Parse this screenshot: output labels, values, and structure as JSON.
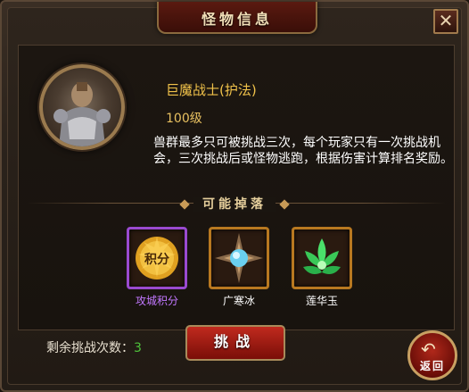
{
  "window": {
    "title": "怪物信息",
    "close_glyph": "✕"
  },
  "monster": {
    "name": "巨魔战士(护法)",
    "level": "100级",
    "description": "兽群最多只可被挑战三次，每个玩家只有一次挑战机会，三次挑战后或怪物逃跑，根据伤害计算排名奖励。"
  },
  "drops": {
    "title": "可能掉落",
    "items": [
      {
        "label": "攻城积分",
        "icon_text": "积分",
        "icon": "points-coin-icon",
        "rarity_color": "#9a4ad0"
      },
      {
        "label": "广寒冰",
        "icon": "ice-crystal-icon",
        "rarity_color": "#b87820"
      },
      {
        "label": "莲华玉",
        "icon": "lotus-jade-icon",
        "rarity_color": "#b87820"
      }
    ]
  },
  "footer": {
    "remaining_label": "剩余挑战次数：",
    "remaining_count": "3",
    "challenge_button": "挑战",
    "back_button": "返回"
  }
}
